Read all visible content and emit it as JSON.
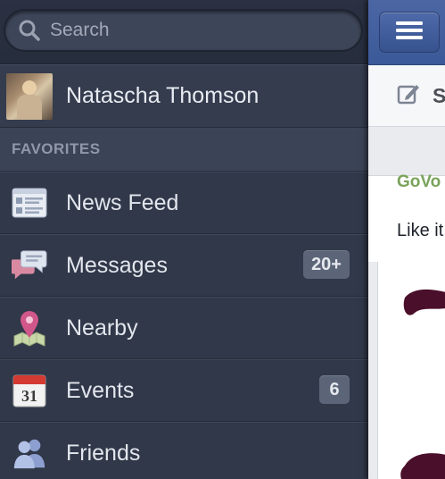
{
  "search": {
    "placeholder": "Search"
  },
  "profile": {
    "name": "Natascha Thomson"
  },
  "favorites": {
    "header": "FAVORITES",
    "items": [
      {
        "label": "News Feed",
        "icon": "news-feed-icon",
        "badge": ""
      },
      {
        "label": "Messages",
        "icon": "messages-icon",
        "badge": "20+"
      },
      {
        "label": "Nearby",
        "icon": "nearby-icon",
        "badge": ""
      },
      {
        "label": "Events",
        "icon": "calendar-icon",
        "calendar_day": "31",
        "badge": "6"
      },
      {
        "label": "Friends",
        "icon": "friends-icon",
        "badge": ""
      }
    ]
  },
  "main": {
    "status_label": "S",
    "story": {
      "page_name": "GoVo",
      "text": "Like it"
    }
  },
  "colors": {
    "sidebar_bg": "#303849",
    "topbar_blue": "#3b5998",
    "badge_bg": "#5c6578"
  }
}
